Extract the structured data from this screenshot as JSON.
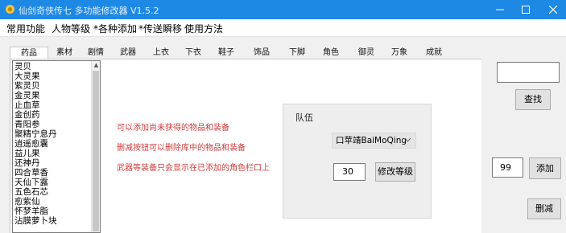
{
  "window": {
    "title": "仙剑奇侠传七 多功能修改器 V1.5.2",
    "icon": "app-icon",
    "accent": "#1e88e5"
  },
  "menu": [
    "常用功能",
    "人物等级",
    "*各种添加",
    "*传送瞬移",
    "使用方法"
  ],
  "sub_tabs": [
    "药品",
    "素材",
    "剧情",
    "武器",
    "上衣",
    "下衣",
    "鞋子",
    "饰品",
    "下脚",
    "角色",
    "御灵",
    "万象",
    "成就"
  ],
  "items": [
    "灵贝",
    "大灵果",
    "紫灵贝",
    "金灵果",
    "止血草",
    "金创药",
    "青阳参",
    "聚精宁息丹",
    "逍遥愈囊",
    "益儿果",
    "还神丹",
    "四合草香",
    "天仙下露",
    "五色石芯",
    "愈紫仙",
    "怀梦羊脂",
    "沾膜萝卜块"
  ],
  "info_lines": [
    "可以添加尚未获得的物品和装备",
    "删减按钮可以删除库中的物品和装备",
    "武器等装备只会显示在已添加的角色栏口上"
  ],
  "team": {
    "label": "队伍",
    "selected_member": "口苹靖BaiMoQing",
    "level_value": "30",
    "modify_button": "修改等级"
  },
  "right_panel": {
    "search_value": "",
    "search_button": "查找",
    "quantity_value": "99",
    "add_button": "添加",
    "delete_button": "删减"
  },
  "colors": {
    "info_text": "#d03a3a",
    "title_bar": "#1e88e5"
  }
}
